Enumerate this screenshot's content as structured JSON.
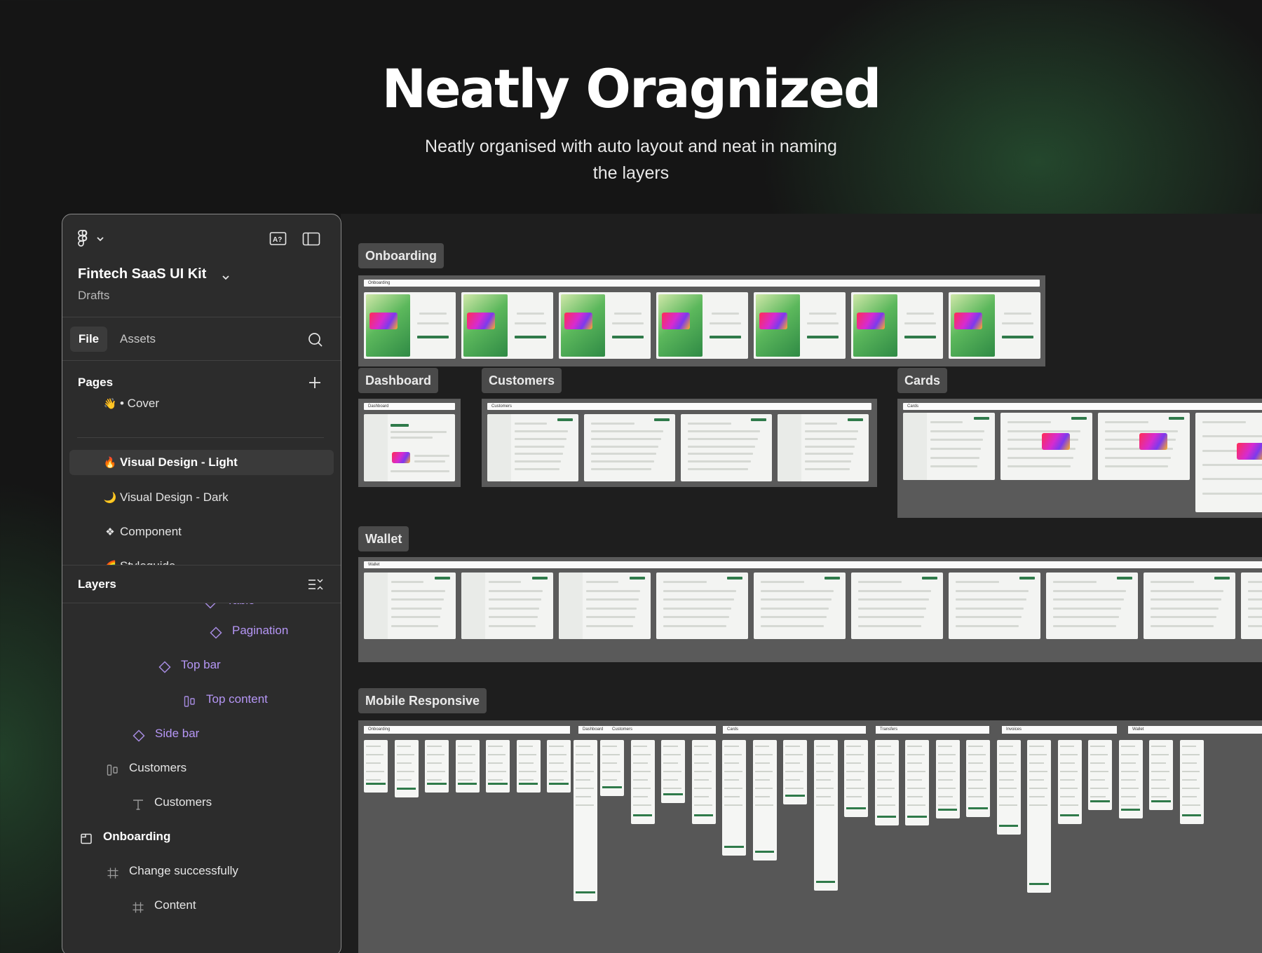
{
  "hero": {
    "title": "Neatly Oragnized",
    "subtitle": "Neatly organised with auto layout and neat in naming the layers"
  },
  "panel": {
    "file_title": "Fintech SaaS UI Kit",
    "file_location": "Drafts",
    "tabs": {
      "file": "File",
      "assets": "Assets"
    },
    "pages_heading": "Pages",
    "pages": [
      {
        "emoji": "👋",
        "label": "• Cover"
      },
      {
        "emoji": "🔥",
        "label": "Visual Design - Light",
        "active": true
      },
      {
        "emoji": "🌙",
        "label": "Visual Design - Dark"
      },
      {
        "emoji": "❖",
        "label": "Component"
      },
      {
        "emoji": "🌈",
        "label": "Styleguide"
      }
    ],
    "layers_heading": "Layers",
    "layers": [
      {
        "label": "Table",
        "icon": "component-diamond-icon"
      },
      {
        "label": "Pagination",
        "icon": "component-diamond-icon"
      },
      {
        "label": "Top bar",
        "icon": "component-diamond-icon"
      },
      {
        "label": "Top content",
        "icon": "auto-layout-icon"
      },
      {
        "label": "Side bar",
        "icon": "component-diamond-icon"
      },
      {
        "label": "Customers",
        "icon": "auto-layout-icon"
      },
      {
        "label": "Customers",
        "icon": "text-icon"
      },
      {
        "label": "Onboarding",
        "icon": "section-icon"
      },
      {
        "label": "Change successfully",
        "icon": "frame-icon"
      },
      {
        "label": "Content",
        "icon": "frame-icon"
      }
    ]
  },
  "canvas": {
    "sections": {
      "onboarding": "Onboarding",
      "dashboard": "Dashboard",
      "customers": "Customers",
      "cards": "Cards",
      "wallet": "Wallet",
      "mobile": "Mobile Responsive"
    },
    "frame_strips": {
      "onboarding": "Onboarding",
      "dashboard": "Dashboard",
      "customers": "Customers",
      "cards": "Cards",
      "wallet": "Wallet"
    },
    "mobile_groups": [
      "Onboarding",
      "Dashboard",
      "Customers",
      "Cards",
      "Transfers",
      "Invoices",
      "Wallet"
    ]
  },
  "colors": {
    "background": "#151515",
    "panel": "#2c2c2c",
    "canvas": "#1e1e1e",
    "frame": "#5a5a5a",
    "component_purple": "#b596f5",
    "brand_green": "#2f7a4a"
  }
}
